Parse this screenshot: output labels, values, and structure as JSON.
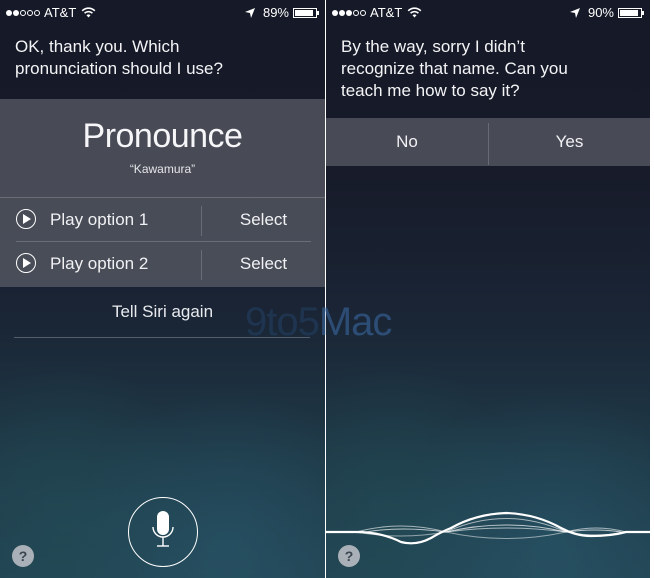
{
  "left_screen": {
    "status_bar": {
      "signal_strength": 2,
      "signal_max": 5,
      "carrier": "AT&T",
      "battery_percent_label": "89%",
      "battery_level": 0.89
    },
    "siri_message": [
      "OK, thank you. Which",
      "pronunciation should I use?"
    ],
    "card": {
      "title": "Pronounce",
      "name": "“Kawamura”",
      "options": [
        {
          "play_label": "Play option 1",
          "select_label": "Select"
        },
        {
          "play_label": "Play option 2",
          "select_label": "Select"
        }
      ]
    },
    "tell_again_label": "Tell Siri again",
    "help_label": "?"
  },
  "right_screen": {
    "status_bar": {
      "signal_strength": 3,
      "signal_max": 5,
      "carrier": "AT&T",
      "battery_percent_label": "90%",
      "battery_level": 0.9
    },
    "siri_message": [
      "By the way, sorry I didn’t",
      "recognize that name. Can you",
      "teach me how to say it?"
    ],
    "buttons": {
      "no_label": "No",
      "yes_label": "Yes"
    },
    "help_label": "?"
  },
  "watermark": {
    "prefix": "9to5",
    "suffix": "Mac"
  }
}
